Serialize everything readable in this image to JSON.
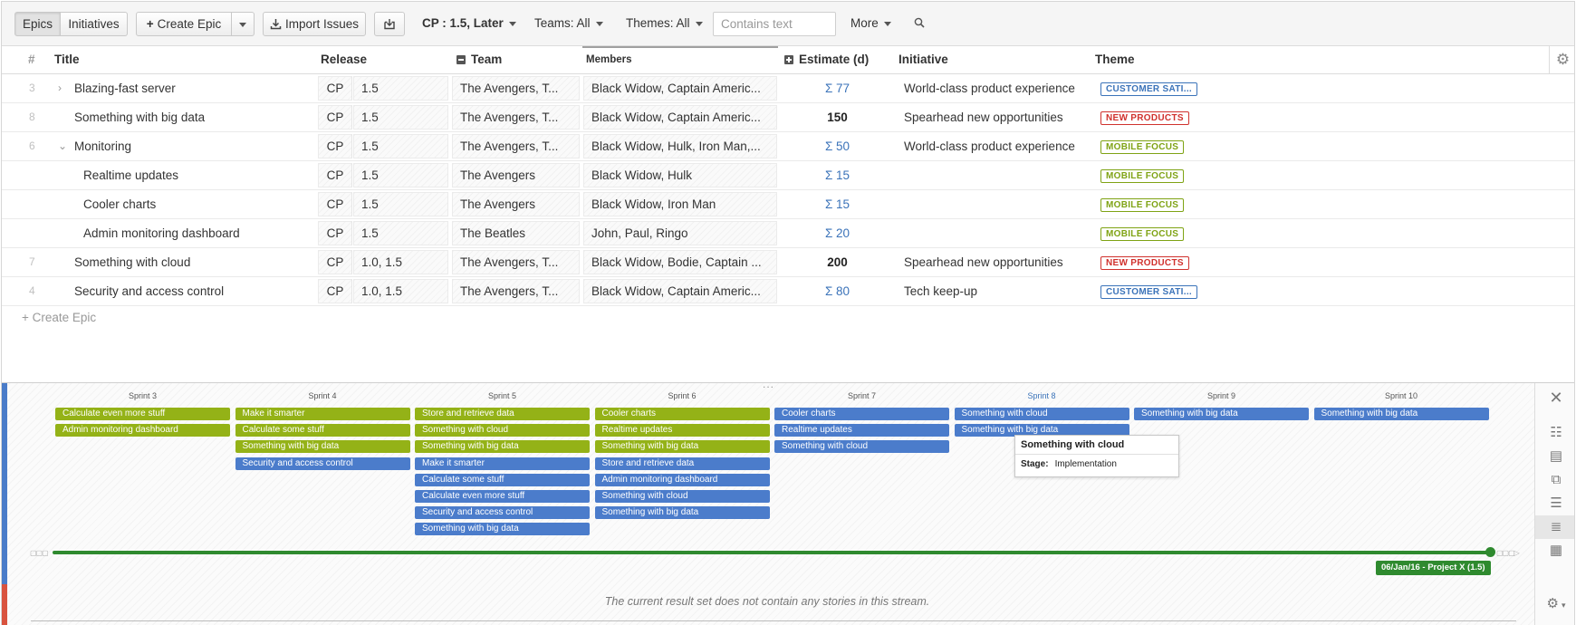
{
  "toolbar": {
    "tab_epics": "Epics",
    "tab_initiatives": "Initiatives",
    "create_epic": "Create Epic",
    "import_issues": "Import Issues",
    "filter_release": "CP : 1.5, Later",
    "filter_teams": "Teams: All",
    "filter_themes": "Themes: All",
    "search_placeholder": "Contains text",
    "more": "More"
  },
  "table": {
    "headers": {
      "num": "#",
      "title": "Title",
      "release": "Release",
      "team": "Team",
      "members": "Members",
      "estimate": "Estimate (d)",
      "initiative": "Initiative",
      "theme": "Theme"
    },
    "rows": [
      {
        "num": "3",
        "chevron": "›",
        "title": "Blazing-fast server",
        "rel_project": "CP",
        "rel_version": "1.5",
        "team": "The Avengers, T...",
        "members": "Black Widow, Captain Americ...",
        "estimate": "Σ 77",
        "initiative": "World-class product experience",
        "theme": "CUSTOMER SATI..."
      },
      {
        "num": "8",
        "chevron": "",
        "title": "Something with big data",
        "rel_project": "CP",
        "rel_version": "1.5",
        "team": "The Avengers, T...",
        "members": "Black Widow, Captain Americ...",
        "estimate": "150",
        "initiative": "Spearhead new opportunities",
        "theme": "NEW PRODUCTS"
      },
      {
        "num": "6",
        "chevron": "⌄",
        "title": "Monitoring",
        "rel_project": "CP",
        "rel_version": "1.5",
        "team": "The Avengers, T...",
        "members": "Black Widow, Hulk, Iron Man,...",
        "estimate": "Σ 50",
        "initiative": "World-class product experience",
        "theme": "MOBILE FOCUS"
      },
      {
        "num": "",
        "chevron": "",
        "title": "Realtime updates",
        "rel_project": "CP",
        "rel_version": "1.5",
        "team": "The Avengers",
        "members": "Black Widow, Hulk",
        "estimate": "Σ 15",
        "initiative": "",
        "theme": "MOBILE FOCUS"
      },
      {
        "num": "",
        "chevron": "",
        "title": "Cooler charts",
        "rel_project": "CP",
        "rel_version": "1.5",
        "team": "The Avengers",
        "members": "Black Widow, Iron Man",
        "estimate": "Σ 15",
        "initiative": "",
        "theme": "MOBILE FOCUS"
      },
      {
        "num": "",
        "chevron": "",
        "title": "Admin monitoring dashboard",
        "rel_project": "CP",
        "rel_version": "1.5",
        "team": "The Beatles",
        "members": "John, Paul, Ringo",
        "estimate": "Σ 20",
        "initiative": "",
        "theme": "MOBILE FOCUS"
      },
      {
        "num": "7",
        "chevron": "",
        "title": "Something with cloud",
        "rel_project": "CP",
        "rel_version": "1.0, 1.5",
        "team": "The Avengers, T...",
        "members": "Black Widow, Bodie, Captain ...",
        "estimate": "200",
        "initiative": "Spearhead new opportunities",
        "theme": "NEW PRODUCTS"
      },
      {
        "num": "4",
        "chevron": "",
        "title": "Security and access control",
        "rel_project": "CP",
        "rel_version": "1.0, 1.5",
        "team": "The Avengers, T...",
        "members": "Black Widow, Captain Americ...",
        "estimate": "Σ 80",
        "initiative": "Tech keep-up",
        "theme": "CUSTOMER SATI..."
      }
    ],
    "create_epic": "+ Create Epic"
  },
  "theme_colors": {
    "CUSTOMER SATI...": "#3b73b9",
    "NEW PRODUCTS": "#d0312d",
    "MOBILE FOCUS": "#7fa314"
  },
  "board": {
    "sprints": [
      "Sprint 3",
      "Sprint 4",
      "Sprint 5",
      "Sprint 6",
      "Sprint 7",
      "Sprint 8",
      "Sprint 9",
      "Sprint 10"
    ],
    "columns": [
      [
        {
          "label": "Calculate even more stuff",
          "color": "g"
        },
        {
          "label": "Admin monitoring dashboard",
          "color": "g"
        }
      ],
      [
        {
          "label": "Make it smarter",
          "color": "g"
        },
        {
          "label": "Calculate some stuff",
          "color": "g"
        },
        {
          "label": "Something with big data",
          "color": "g"
        },
        {
          "label": "Security and access control",
          "color": "b"
        }
      ],
      [
        {
          "label": "Store and retrieve data",
          "color": "g"
        },
        {
          "label": "Something with cloud",
          "color": "g"
        },
        {
          "label": "Something with big data",
          "color": "g"
        },
        {
          "label": "Make it smarter",
          "color": "b"
        },
        {
          "label": "Calculate some stuff",
          "color": "b"
        },
        {
          "label": "Calculate even more stuff",
          "color": "b"
        },
        {
          "label": "Security and access control",
          "color": "b"
        },
        {
          "label": "Something with big data",
          "color": "b"
        }
      ],
      [
        {
          "label": "Cooler charts",
          "color": "g"
        },
        {
          "label": "Realtime updates",
          "color": "g"
        },
        {
          "label": "Something with big data",
          "color": "g"
        },
        {
          "label": "Store and retrieve data",
          "color": "b"
        },
        {
          "label": "Admin monitoring dashboard",
          "color": "b"
        },
        {
          "label": "Something with cloud",
          "color": "b"
        },
        {
          "label": "Something with big data",
          "color": "b"
        }
      ],
      [
        {
          "label": "Cooler charts",
          "color": "b"
        },
        {
          "label": "Realtime updates",
          "color": "b"
        },
        {
          "label": "Something with cloud",
          "color": "b"
        }
      ],
      [
        {
          "label": "Something with cloud",
          "color": "b"
        },
        {
          "label": "Something with big data",
          "color": "b"
        }
      ],
      [
        {
          "label": "Something with big data",
          "color": "b"
        }
      ],
      [
        {
          "label": "Something with big data",
          "color": "b"
        }
      ]
    ],
    "tooltip": {
      "title": "Something with cloud",
      "stage_label": "Stage:",
      "stage_value": "Implementation"
    },
    "release_tag": "06/Jan/16 - Project X (1.5)",
    "empty_message": "The current result set does not contain any stories in this stream.",
    "splitter": "..."
  },
  "icons": {
    "close": "close-icon",
    "settings": "gear-icon",
    "search": "search-icon",
    "import": "download-icon",
    "export": "export-icon"
  }
}
